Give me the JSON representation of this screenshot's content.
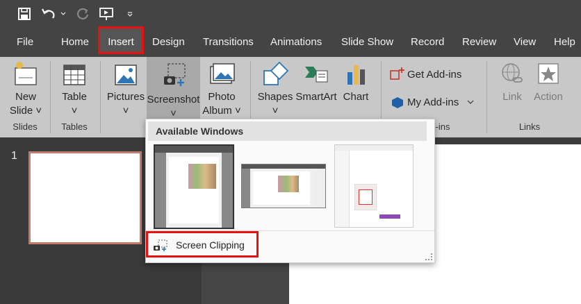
{
  "tabs": [
    "File",
    "Home",
    "Insert",
    "Design",
    "Transitions",
    "Animations",
    "Slide Show",
    "Record",
    "Review",
    "View",
    "Help"
  ],
  "active_tab": "Insert",
  "ribbon": {
    "new_slide": [
      "New",
      "Slide ˅"
    ],
    "table": [
      "Table",
      "˅"
    ],
    "pictures": [
      "Pictures",
      "˅"
    ],
    "screenshot": [
      "Screenshot",
      "˅"
    ],
    "photo_album": [
      "Photo",
      "Album ˅"
    ],
    "shapes": [
      "Shapes",
      "˅"
    ],
    "smartart": "SmartArt",
    "chart": "Chart",
    "get_addins": "Get Add-ins",
    "my_addins": "My Add-ins",
    "link": "Link",
    "action": "Action",
    "groups": {
      "slides": "Slides",
      "tables": "Tables",
      "addins": "-ins",
      "links": "Links"
    }
  },
  "slide_number": "1",
  "dropdown": {
    "header": "Available Windows",
    "screen_clipping": "Screen Clipping"
  },
  "colors": {
    "highlight": "#e81010",
    "ribbon": "#c8c8c8",
    "titlebar": "#444444"
  }
}
